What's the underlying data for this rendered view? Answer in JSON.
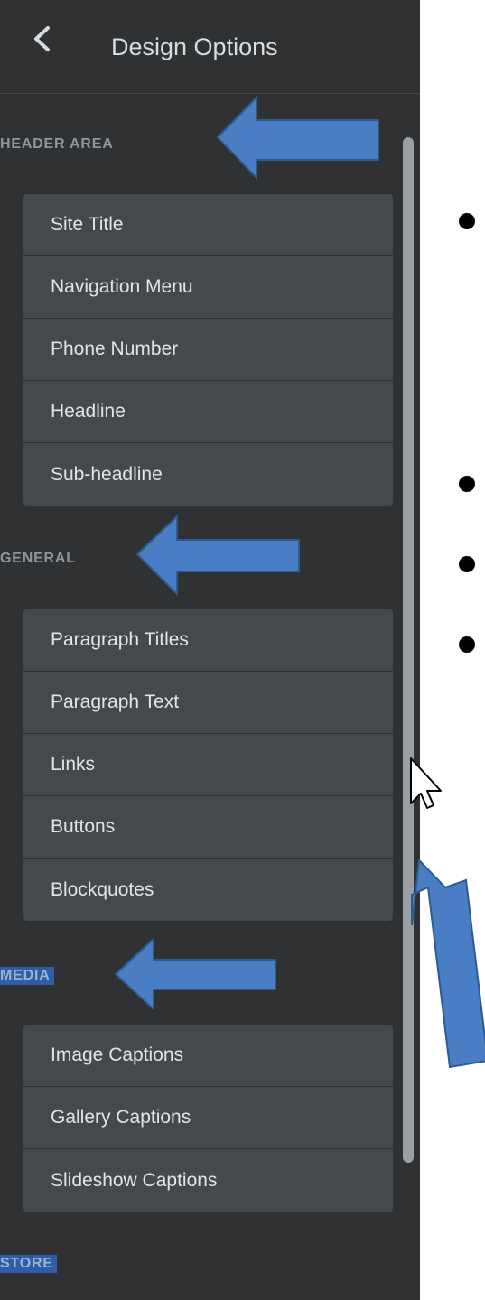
{
  "panel": {
    "title": "Design Options",
    "back_icon": "chevron-left-icon"
  },
  "sections": [
    {
      "label": "HEADER AREA",
      "items": [
        "Site Title",
        "Navigation Menu",
        "Phone Number",
        "Headline",
        "Sub-headline"
      ]
    },
    {
      "label": "GENERAL",
      "items": [
        "Paragraph Titles",
        "Paragraph Text",
        "Links",
        "Buttons",
        "Blockquotes"
      ]
    },
    {
      "label": "MEDIA",
      "items": [
        "Image Captions",
        "Gallery Captions",
        "Slideshow Captions"
      ]
    },
    {
      "label": "STORE",
      "items": []
    }
  ],
  "colors": {
    "panel_bg": "#2f3133",
    "item_bg": "#45494c",
    "annotation_arrow": "#4a7ec4",
    "highlight": "#2e5ea8"
  },
  "icons": {
    "cursor": "mouse-pointer-icon",
    "bullet": "bullet-dot-icon"
  }
}
